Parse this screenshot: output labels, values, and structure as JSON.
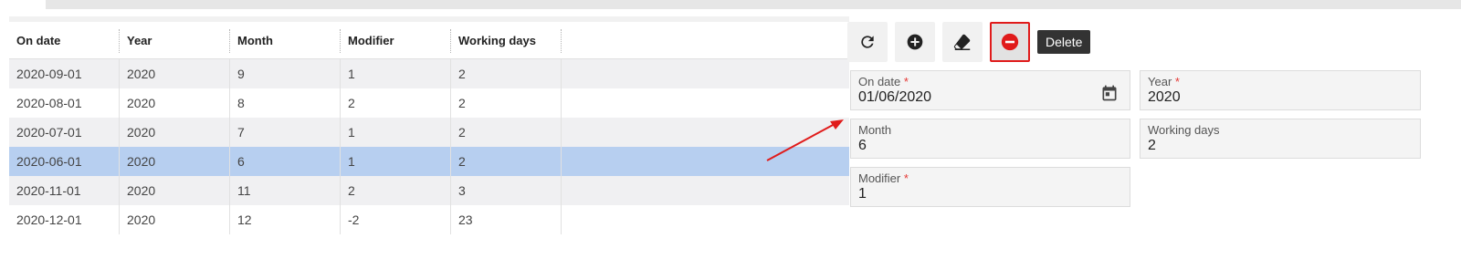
{
  "grid": {
    "columns": [
      "On date",
      "Year",
      "Month",
      "Modifier",
      "Working days"
    ],
    "rows": [
      [
        "2020-09-01",
        "2020",
        "9",
        "1",
        "2"
      ],
      [
        "2020-08-01",
        "2020",
        "8",
        "2",
        "2"
      ],
      [
        "2020-07-01",
        "2020",
        "7",
        "1",
        "2"
      ],
      [
        "2020-06-01",
        "2020",
        "6",
        "1",
        "2"
      ],
      [
        "2020-11-01",
        "2020",
        "11",
        "2",
        "3"
      ],
      [
        "2020-12-01",
        "2020",
        "12",
        "-2",
        "23"
      ]
    ],
    "selected_row_index": 3
  },
  "toolbar": {
    "buttons": [
      {
        "icon": "refresh-icon"
      },
      {
        "icon": "add-circle-icon"
      },
      {
        "icon": "eraser-icon"
      },
      {
        "icon": "remove-circle-icon",
        "active": true
      }
    ],
    "tooltip": "Delete"
  },
  "form": {
    "on_date": {
      "label": "On date",
      "required": "*",
      "value": "01/06/2020"
    },
    "year": {
      "label": "Year",
      "required": "*",
      "value": "2020"
    },
    "month": {
      "label": "Month",
      "value": "6"
    },
    "working_days": {
      "label": "Working days",
      "value": "2"
    },
    "modifier": {
      "label": "Modifier",
      "required": "*",
      "value": "1"
    }
  },
  "colors": {
    "selected_row": "#b7cff0",
    "delete_icon": "#e01b1b",
    "required_mark": "#e53935",
    "arrow": "#e01b1b"
  }
}
